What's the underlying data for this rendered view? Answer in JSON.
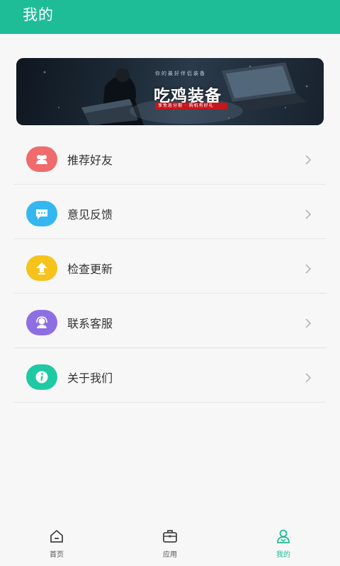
{
  "header": {
    "title": "我的"
  },
  "banner": {
    "slogan": "吃鸡装备",
    "small_text": "你的最好伴侣装备",
    "strip_text": "享免息分期 · 购机有好礼",
    "image": "gaming-laptop-ad"
  },
  "menu": {
    "items": [
      {
        "label": "推荐好友",
        "icon": "people-icon",
        "color": "#f06b6b"
      },
      {
        "label": "意见反馈",
        "icon": "message-icon",
        "color": "#34b7f1"
      },
      {
        "label": "检查更新",
        "icon": "upload-arrow-icon",
        "color": "#f6c21c"
      },
      {
        "label": "联系客服",
        "icon": "headset-icon",
        "color": "#8e6fe3"
      },
      {
        "label": "关于我们",
        "icon": "info-icon",
        "color": "#1fc9a4"
      }
    ]
  },
  "tabbar": {
    "tabs": [
      {
        "label": "首页",
        "icon": "home-icon"
      },
      {
        "label": "应用",
        "icon": "briefcase-icon"
      },
      {
        "label": "我的",
        "icon": "profile-icon",
        "active": true
      }
    ]
  },
  "colors": {
    "accent": "#1fbc98"
  }
}
